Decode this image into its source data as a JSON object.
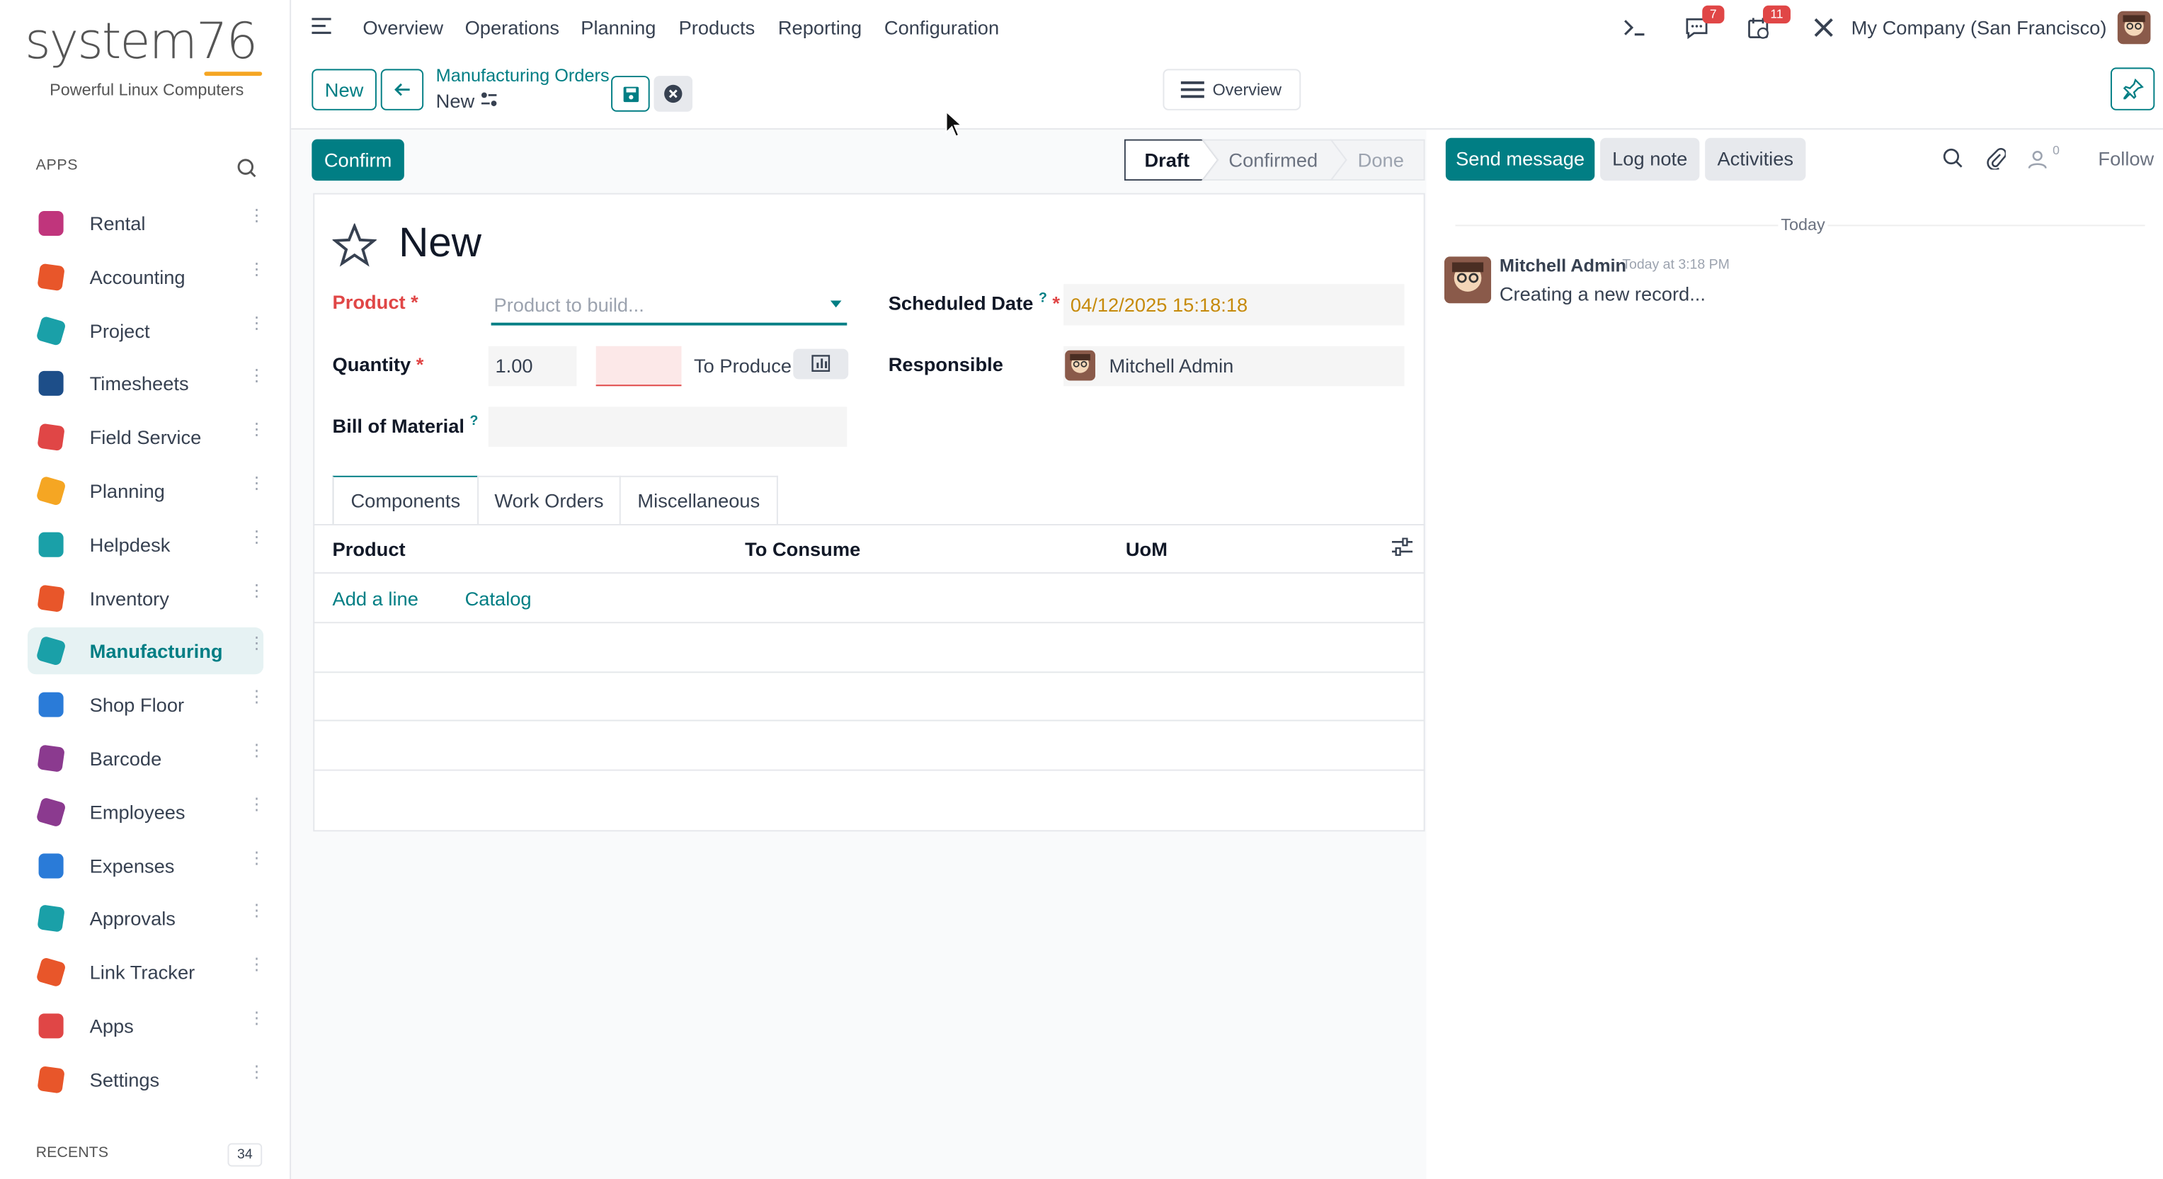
{
  "brand": {
    "logo_text": "system76",
    "tagline": "Powerful Linux Computers"
  },
  "sidebar": {
    "apps_heading": "APPS",
    "items": [
      {
        "label": "Rental",
        "icon": "rental-icon",
        "color": "#c0357c"
      },
      {
        "label": "Accounting",
        "icon": "accounting-icon",
        "color": "#e8562a"
      },
      {
        "label": "Project",
        "icon": "project-icon",
        "color": "#1aa0a8"
      },
      {
        "label": "Timesheets",
        "icon": "timesheets-icon",
        "color": "#1d4e89"
      },
      {
        "label": "Field Service",
        "icon": "field-service-icon",
        "color": "#e04646"
      },
      {
        "label": "Planning",
        "icon": "planning-icon",
        "color": "#f5a623"
      },
      {
        "label": "Helpdesk",
        "icon": "helpdesk-icon",
        "color": "#1aa0a8"
      },
      {
        "label": "Inventory",
        "icon": "inventory-icon",
        "color": "#e8562a"
      },
      {
        "label": "Manufacturing",
        "icon": "manufacturing-icon",
        "color": "#1aa0a8"
      },
      {
        "label": "Shop Floor",
        "icon": "shop-floor-icon",
        "color": "#2a7bd8"
      },
      {
        "label": "Barcode",
        "icon": "barcode-icon",
        "color": "#8b3a8f"
      },
      {
        "label": "Employees",
        "icon": "employees-icon",
        "color": "#8b3a8f"
      },
      {
        "label": "Expenses",
        "icon": "expenses-icon",
        "color": "#2a7bd8"
      },
      {
        "label": "Approvals",
        "icon": "approvals-icon",
        "color": "#1aa0a8"
      },
      {
        "label": "Link Tracker",
        "icon": "link-tracker-icon",
        "color": "#e8562a"
      },
      {
        "label": "Apps",
        "icon": "apps-icon",
        "color": "#e04646"
      },
      {
        "label": "Settings",
        "icon": "settings-icon",
        "color": "#e8562a"
      }
    ],
    "active": "Manufacturing",
    "recents_heading": "RECENTS",
    "recents_count": "34"
  },
  "topbar": {
    "menu": [
      "Overview",
      "Operations",
      "Planning",
      "Products",
      "Reporting",
      "Configuration"
    ],
    "messages_badge": "7",
    "activities_badge": "11",
    "company": "My Company (San Francisco)"
  },
  "control": {
    "new_label": "New",
    "breadcrumb_parent": "Manufacturing Orders",
    "breadcrumb_current": "New",
    "overview_label": "Overview"
  },
  "actions": {
    "confirm_label": "Confirm",
    "stages": [
      "Draft",
      "Confirmed",
      "Done"
    ],
    "current_stage": "Draft"
  },
  "form": {
    "title": "New",
    "product_label": "Product",
    "product_placeholder": "Product to build...",
    "quantity_label": "Quantity",
    "quantity_value": "1.00",
    "to_produce_label": "To Produce",
    "bom_label": "Bill of Material",
    "scheduled_date_label": "Scheduled Date",
    "scheduled_date_value": "04/12/2025 15:18:18",
    "responsible_label": "Responsible",
    "responsible_value": "Mitchell Admin",
    "required_mark": "*",
    "help_mark": "?",
    "tabs": [
      "Components",
      "Work Orders",
      "Miscellaneous"
    ],
    "columns": [
      "Product",
      "To Consume",
      "UoM"
    ],
    "add_line": "Add a line",
    "catalog": "Catalog"
  },
  "chatter": {
    "send_message": "Send message",
    "log_note": "Log note",
    "activities": "Activities",
    "followers_count": "0",
    "follow": "Follow",
    "date_separator": "Today",
    "message": {
      "author": "Mitchell Admin",
      "time": "Today at 3:18 PM",
      "body": "Creating a new record..."
    }
  },
  "colors": {
    "primary": "#017e84",
    "danger": "#e04646",
    "date": "#c68a0a"
  }
}
